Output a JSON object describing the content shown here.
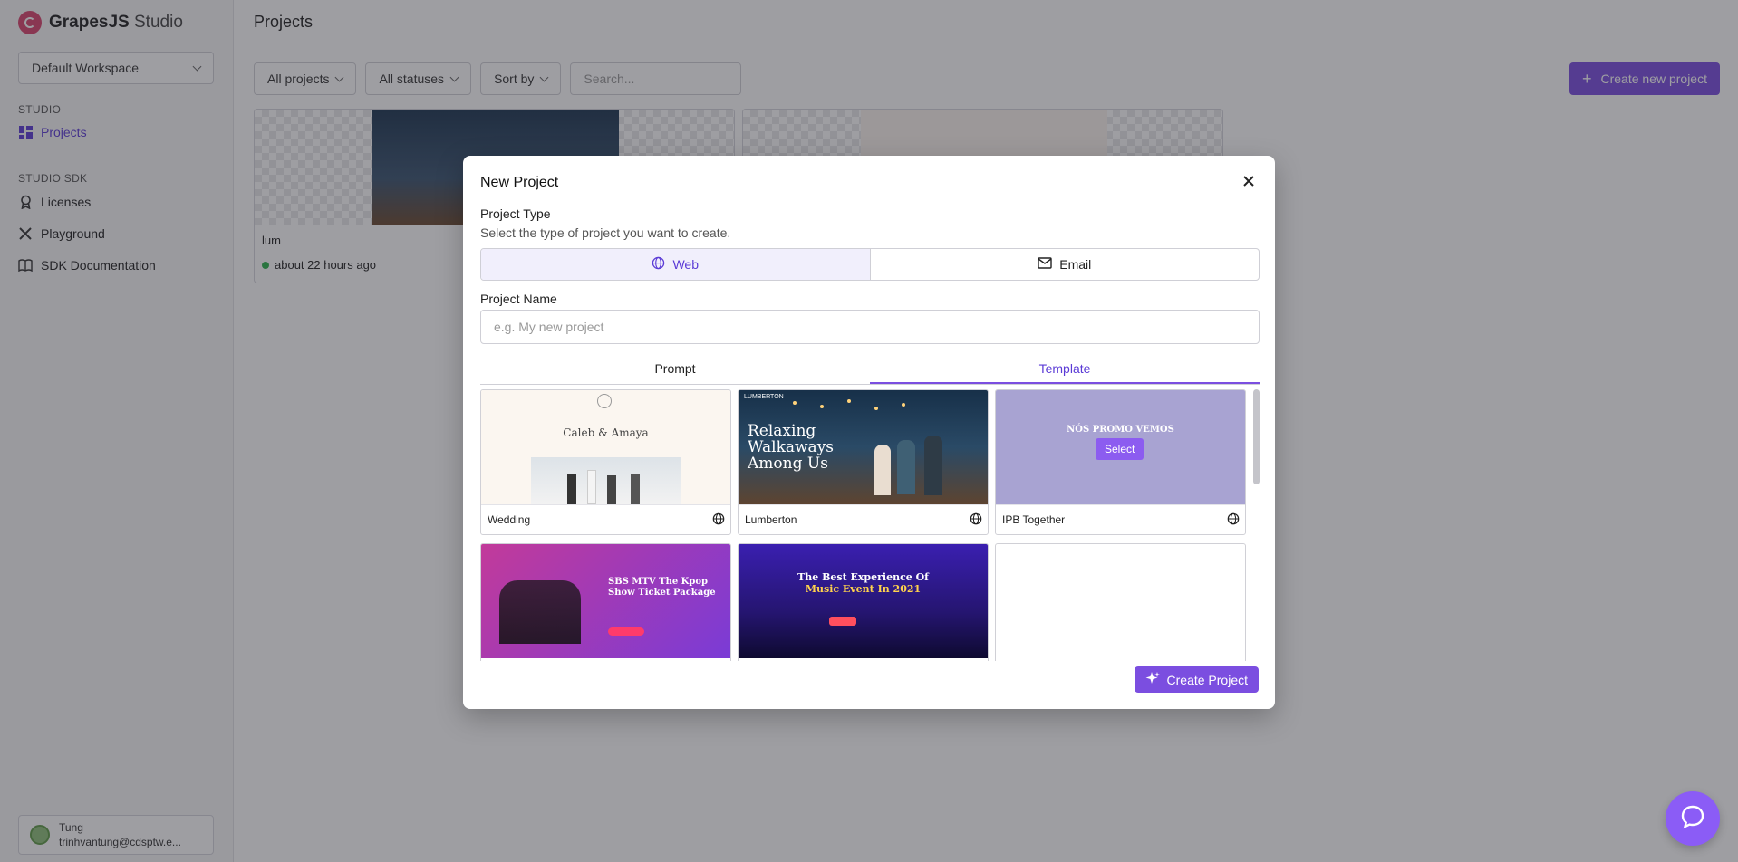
{
  "brand": {
    "name_bold": "GrapesJS",
    "name_rest": " Studio"
  },
  "workspace": {
    "label": "Default Workspace"
  },
  "sidebar": {
    "studio_title": "STUDIO",
    "sdk_title": "STUDIO SDK",
    "items": [
      {
        "label": "Projects",
        "icon": "grid-icon",
        "active": true
      },
      {
        "label": "Licenses",
        "icon": "badge-icon"
      },
      {
        "label": "Playground",
        "icon": "tools-icon"
      },
      {
        "label": "SDK Documentation",
        "icon": "book-icon"
      }
    ]
  },
  "user": {
    "name": "Tung",
    "email": "trinhvantung@cdsptw.e..."
  },
  "main": {
    "title": "Projects",
    "filters": [
      "All projects",
      "All statuses",
      "Sort by"
    ],
    "search_placeholder": "Search...",
    "create_button": "Create new project",
    "project_card": {
      "name": "lum",
      "updated": "about 22 hours ago"
    }
  },
  "modal": {
    "title": "New Project",
    "type_label": "Project Type",
    "type_hint": "Select the type of project you want to create.",
    "type_web": "Web",
    "type_email": "Email",
    "name_label": "Project Name",
    "name_placeholder": "e.g. My new project",
    "tab_prompt": "Prompt",
    "tab_template": "Template",
    "templates": [
      {
        "name": "Wedding"
      },
      {
        "name": "Lumberton"
      },
      {
        "name": "IPB Together"
      }
    ],
    "select_label": "Select",
    "create_label": "Create Project",
    "thumb_text": {
      "wedding_title": "Caleb & Amaya",
      "lumberton_logo": "LUMBERTON",
      "lumberton_h1": "Relaxing",
      "lumberton_h2": "Walkaways",
      "lumberton_h3": "Among Us",
      "ipb_heading": "NÓS PROMO VEMOS",
      "kpop_title": "SBS MTV The Kpop Show Ticket Package",
      "music_title": "The Best Experience Of",
      "music_title2": "Music Event In 2021"
    }
  },
  "colors": {
    "accent": "#7b4ee0",
    "overlay": "rgba(40,40,48,0.45)"
  }
}
